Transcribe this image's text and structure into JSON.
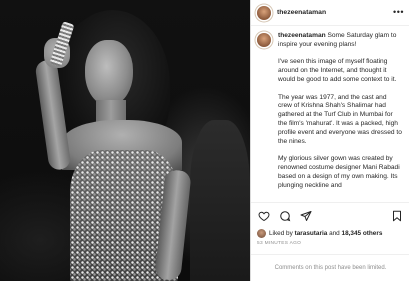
{
  "post": {
    "username": "thezeenataman",
    "caption": {
      "intro": "Some Saturday glam to inspire your evening plans!",
      "paragraphs": [
        "I've seen this image of myself floating around on the Internet, and thought it would be good to add some context to it.",
        "The year was 1977, and the cast and crew of Krishna Shah's Shalimar had gathered at the Turf Club in Mumbai for the film's 'mahurat'. It was a packed, high profile event and everyone was dressed to the nines.",
        "My glorious silver gown was created by renowned costume designer Mani Rabadi based on a design of my own making. Its plunging neckline and"
      ]
    },
    "likes": {
      "prefix": "Liked by",
      "first_user": "tarasutaria",
      "connector": "and",
      "others": "18,345 others"
    },
    "timestamp": "53 MINUTES AGO",
    "comments_notice": "Comments on this post have been limited."
  },
  "icons": {
    "more": "more-horizontal-icon",
    "like": "heart-icon",
    "comment": "comment-icon",
    "share": "paper-plane-icon",
    "save": "bookmark-icon"
  }
}
